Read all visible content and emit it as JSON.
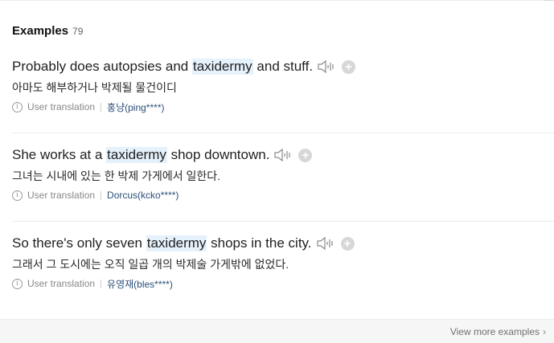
{
  "header": {
    "title": "Examples",
    "count": "79"
  },
  "examples": [
    {
      "before": "Probably does autopsies and ",
      "highlight": "taxidermy",
      "after": " and stuff.",
      "translation": "아마도 해부하거나 박제될 물건이디",
      "source_label": "User translation",
      "user": "홍냥(ping****)"
    },
    {
      "before": "She works at a ",
      "highlight": "taxidermy",
      "after": " shop downtown.",
      "translation": "그녀는 시내에 있는 한 박제 가게에서 일한다.",
      "source_label": "User translation",
      "user": "Dorcus(kcko****)"
    },
    {
      "before": "So there's only seven ",
      "highlight": "taxidermy",
      "after": " shops in the city.",
      "translation": "그래서 그 도시에는 오직 일곱 개의 박제술 가게밖에 없었다.",
      "source_label": "User translation",
      "user": "유영재(bles****)"
    }
  ],
  "footer": {
    "more_label": "View more examples",
    "chevron": "›"
  },
  "icons": {
    "speaker": "speaker-icon",
    "add": "plus-circle-icon",
    "info": "info-circle-icon"
  },
  "colors": {
    "highlight": "#e5f1fb",
    "user_link": "#2c4f7a",
    "add_button": "#d7d7d7"
  }
}
